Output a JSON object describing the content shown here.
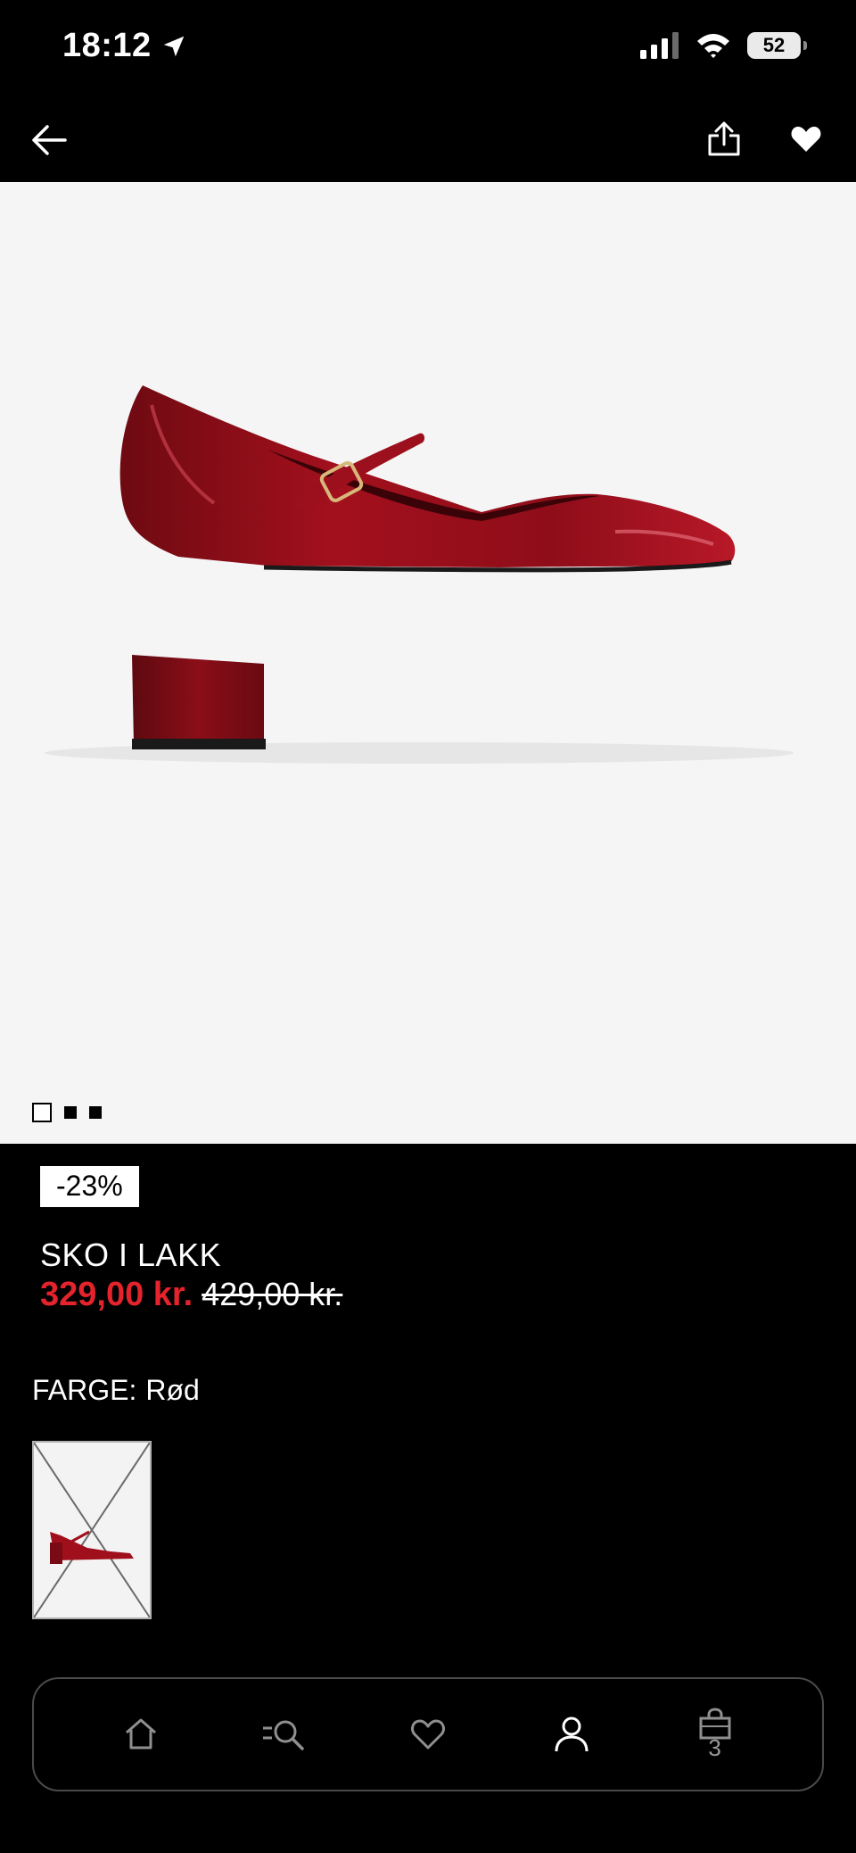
{
  "status_bar": {
    "time": "18:12",
    "battery": "52"
  },
  "header": {
    "back_icon": "arrow-left-icon",
    "share_icon": "share-icon",
    "favorite_icon": "heart-filled-icon"
  },
  "gallery": {
    "total_images": 3,
    "active_index": 0
  },
  "product": {
    "discount": "-23%",
    "title": "SKO I LAKK",
    "price": "329,00 kr.",
    "old_price": "429,00 kr.",
    "color_label": "FARGE:",
    "color_value": "Rød"
  },
  "colors": {
    "sale_red": "#e4232c",
    "shoe_red": "#a0101c"
  },
  "bottom_nav": {
    "items": [
      {
        "name": "home",
        "icon": "home-icon"
      },
      {
        "name": "search",
        "icon": "search-icon"
      },
      {
        "name": "wishlist",
        "icon": "heart-outline-icon"
      },
      {
        "name": "account",
        "icon": "user-icon"
      },
      {
        "name": "bag",
        "icon": "shopping-bag-icon"
      }
    ],
    "bag_count": "3"
  }
}
